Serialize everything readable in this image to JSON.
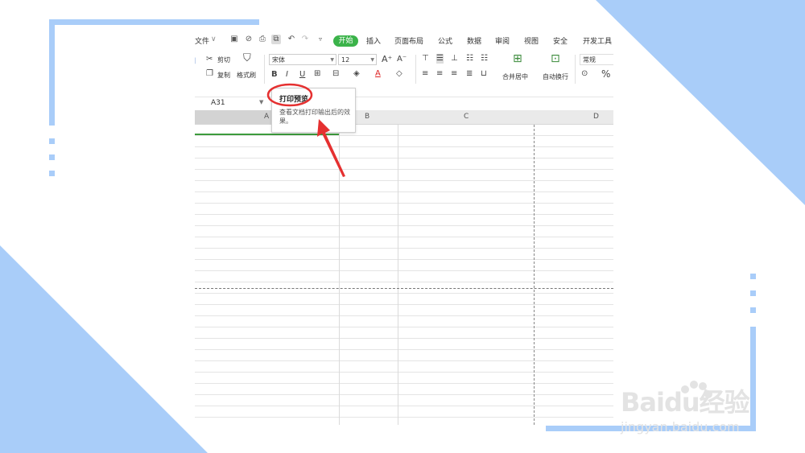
{
  "menu": {
    "items": [
      "文件",
      "开始",
      "插入",
      "页面布局",
      "公式",
      "数据",
      "审阅",
      "视图",
      "安全",
      "开发工具"
    ],
    "active": "开始"
  },
  "ribbon": {
    "cut_label": "剪切",
    "copy_label": "复制",
    "format_painter_label": "格式刷",
    "font_name": "宋体",
    "font_size": "12",
    "bold": "B",
    "italic": "I",
    "underline": "U",
    "font_color_glyph": "A",
    "merge_center_label": "合并居中",
    "wrap_text_label": "自动换行",
    "number_format": "常规",
    "percent_glyph": "%"
  },
  "formula_bar": {
    "name_box": "A31"
  },
  "columns": [
    "A",
    "B",
    "C",
    "D"
  ],
  "tooltip": {
    "title": "打印预览",
    "body": "查看文档打印输出后的效果。"
  },
  "watermark": {
    "brand": "Baidu经验",
    "url": "jingyan.baidu.com"
  },
  "colors": {
    "accent_green": "#3bb34a",
    "decor_blue": "#a9cdf9",
    "annotation_red": "#e53030"
  },
  "icons": [
    "save-icon",
    "print-icon",
    "print-preview-icon",
    "undo-icon",
    "redo-icon",
    "scissors-icon",
    "copy-icon",
    "brush-icon",
    "border-icon",
    "fill-color-icon",
    "eraser-icon",
    "align-icon",
    "merge-icon",
    "wrap-icon"
  ]
}
